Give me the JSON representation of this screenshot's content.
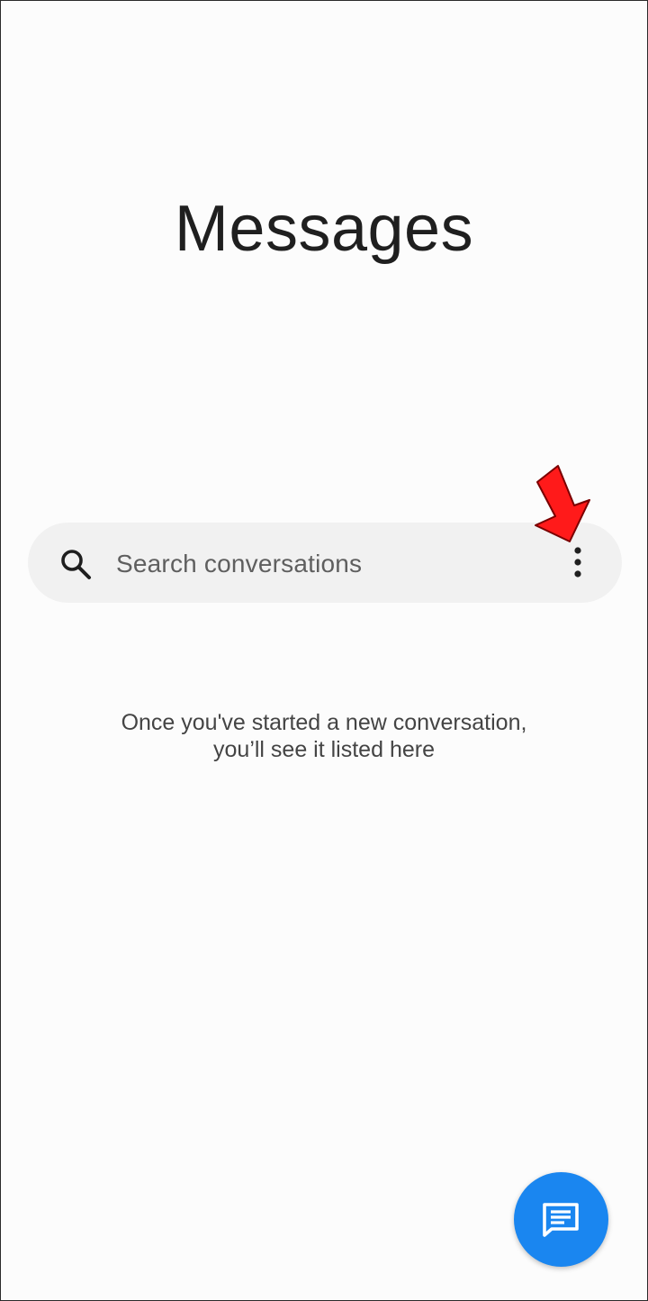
{
  "app": {
    "title": "Messages"
  },
  "search": {
    "placeholder": "Search conversations",
    "icon": "search-icon"
  },
  "menu": {
    "icon": "more-vert-icon"
  },
  "empty_state": {
    "line1": "Once you've started a new conversation,",
    "line2": "you’ll see it listed here"
  },
  "fab": {
    "icon": "new-message-icon",
    "color": "#1a86f0"
  },
  "annotation": {
    "arrow_color": "#ff0000"
  }
}
